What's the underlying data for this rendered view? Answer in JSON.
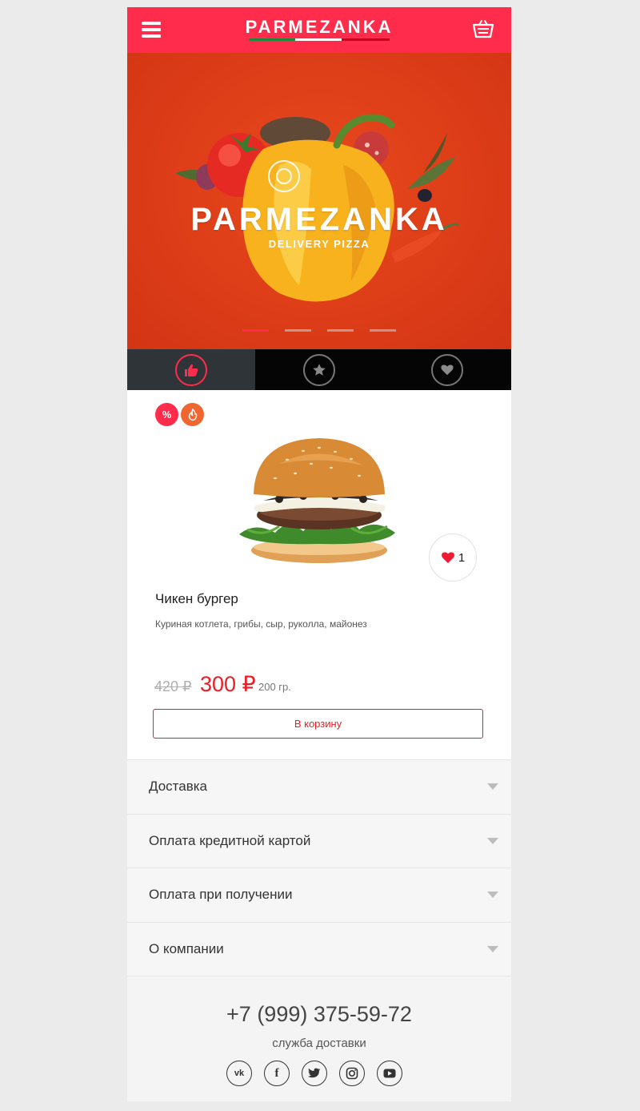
{
  "header": {
    "logo_text": "PARMEZANKA",
    "menu_icon": "hamburger-menu-icon",
    "cart_icon": "basket-icon",
    "accent_color": "#ff2c4b"
  },
  "hero": {
    "title": "PARMEZANKA",
    "subtitle": "DELIVERY PIZZA",
    "slides_total": 4,
    "active_slide": 1,
    "background_color": "#dd3d18"
  },
  "tabs": [
    {
      "icon": "thumbs-up-icon",
      "active": true
    },
    {
      "icon": "star-icon",
      "active": false
    },
    {
      "icon": "heart-icon",
      "active": false
    }
  ],
  "product": {
    "badges": [
      {
        "label": "%",
        "icon": "percent-icon",
        "color": "#ff2c4b"
      },
      {
        "label": "",
        "icon": "flame-icon",
        "color": "#f06530"
      }
    ],
    "name": "Чикен бургер",
    "description": "Куриная котлета, грибы, сыр, руколла, майонез",
    "old_price": "420 ₽",
    "price": "300 ₽",
    "weight": "200 гр.",
    "likes": "1",
    "add_to_cart_label": "В корзину",
    "price_color": "#ee1c25"
  },
  "accordion": [
    {
      "label": "Доставка"
    },
    {
      "label": "Оплата кредитной картой"
    },
    {
      "label": "Оплата при получении"
    },
    {
      "label": "О компании"
    }
  ],
  "footer": {
    "phone": "+7 (999) 375-59-72",
    "phone_caption": "служба доставки",
    "socials": [
      {
        "icon": "vk-icon",
        "label": "vk"
      },
      {
        "icon": "facebook-icon",
        "label": "f"
      },
      {
        "icon": "twitter-icon",
        "label": "twitter"
      },
      {
        "icon": "instagram-icon",
        "label": "instagram"
      },
      {
        "icon": "youtube-icon",
        "label": "youtube"
      }
    ]
  }
}
